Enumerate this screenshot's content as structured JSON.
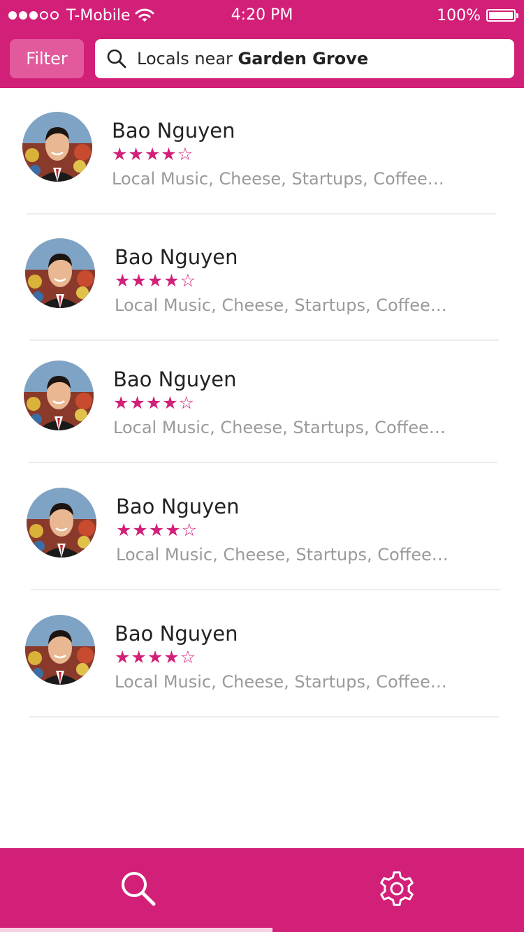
{
  "status_bar": {
    "carrier": "T-Mobile",
    "time": "4:20 PM",
    "battery": "100%"
  },
  "header": {
    "filter_label": "Filter",
    "search_prefix": "Locals near ",
    "search_location": "Garden Grove"
  },
  "locals": [
    {
      "name": "Bao Nguyen",
      "stars": "★★★★☆",
      "rating": 4,
      "tags": "Local Music, Cheese, Startups, Coffee…"
    },
    {
      "name": "Bao Nguyen",
      "stars": "★★★★☆",
      "rating": 4,
      "tags": "Local Music, Cheese, Startups, Coffee…"
    },
    {
      "name": "Bao Nguyen",
      "stars": "★★★★☆",
      "rating": 4,
      "tags": "Local Music, Cheese, Startups, Coffee…"
    },
    {
      "name": "Bao Nguyen",
      "stars": "★★★★☆",
      "rating": 4,
      "tags": "Local Music, Cheese, Startups, Coffee…"
    },
    {
      "name": "Bao Nguyen",
      "stars": "★★★★☆",
      "rating": 4,
      "tags": "Local Music, Cheese, Startups, Coffee…"
    }
  ],
  "tabbar": {
    "tabs": [
      {
        "icon": "search-icon",
        "active": true
      },
      {
        "icon": "gear-icon",
        "active": false
      }
    ]
  },
  "colors": {
    "brand": "#d21f78",
    "filter_button": "#e2599c",
    "tag_text": "#9a9a9a",
    "active_tab_indicator": "#f7d0e4"
  }
}
